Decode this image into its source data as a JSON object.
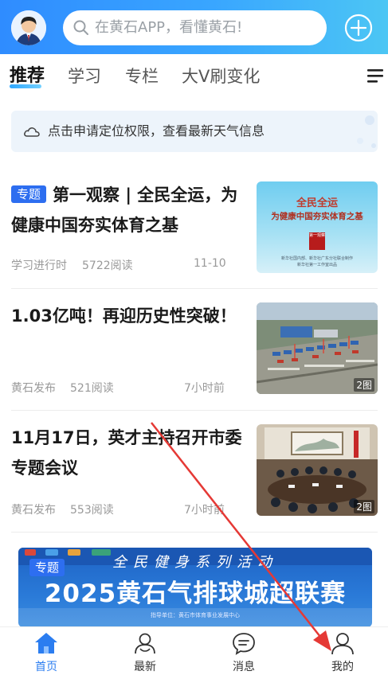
{
  "header": {
    "search_placeholder": "在黄石APP，看懂黄石!",
    "avatar_icon": "user-avatar-icon",
    "add_icon": "plus-circle-icon",
    "gradient_start": "#2f8cff",
    "gradient_end": "#4cc6f4"
  },
  "tabs": [
    {
      "label": "推荐",
      "active": true
    },
    {
      "label": "学习"
    },
    {
      "label": "专栏"
    },
    {
      "label": "大V刷变化"
    }
  ],
  "weather": {
    "text": "点击申请定位权限，查看最新天气信息",
    "icon": "cloud-icon"
  },
  "articles": [
    {
      "tag": "专题",
      "title": "第一观察 | 全民全运，为健康中国夯实体育之基",
      "source": "学习进行时",
      "reads": "5722阅读",
      "time": "11-10",
      "thumb": {
        "line1": "全民全运",
        "line2": "为健康中国夯实体育之基",
        "seal": "第一观察",
        "credit1": "新华社国内部、新华社广东分社联合制作",
        "credit2": "新华社第一工作室出品"
      }
    },
    {
      "title": "1.03亿吨！再迎历史性突破！",
      "source": "黄石发布",
      "reads": "521阅读",
      "time": "7小时前",
      "image_count": "2图"
    },
    {
      "title": "11月17日，英才主持召开市委专题会议",
      "source": "黄石发布",
      "reads": "553阅读",
      "time": "7小时前",
      "image_count": "2图"
    }
  ],
  "banner": {
    "tag": "专题",
    "subtitle": "全民健身系列活动",
    "title": "2025黄石气排球城超联赛",
    "small_text": "指导单位：黄石市体育事业发展中心"
  },
  "bottom_nav": [
    {
      "label": "首页",
      "icon": "home-icon",
      "active": true
    },
    {
      "label": "最新",
      "icon": "people-icon"
    },
    {
      "label": "消息",
      "icon": "message-icon"
    },
    {
      "label": "我的",
      "icon": "profile-icon"
    }
  ],
  "colors": {
    "accent": "#2b7df0",
    "tag_bg": "#2d6ef0",
    "annotation_arrow": "#e53935"
  }
}
